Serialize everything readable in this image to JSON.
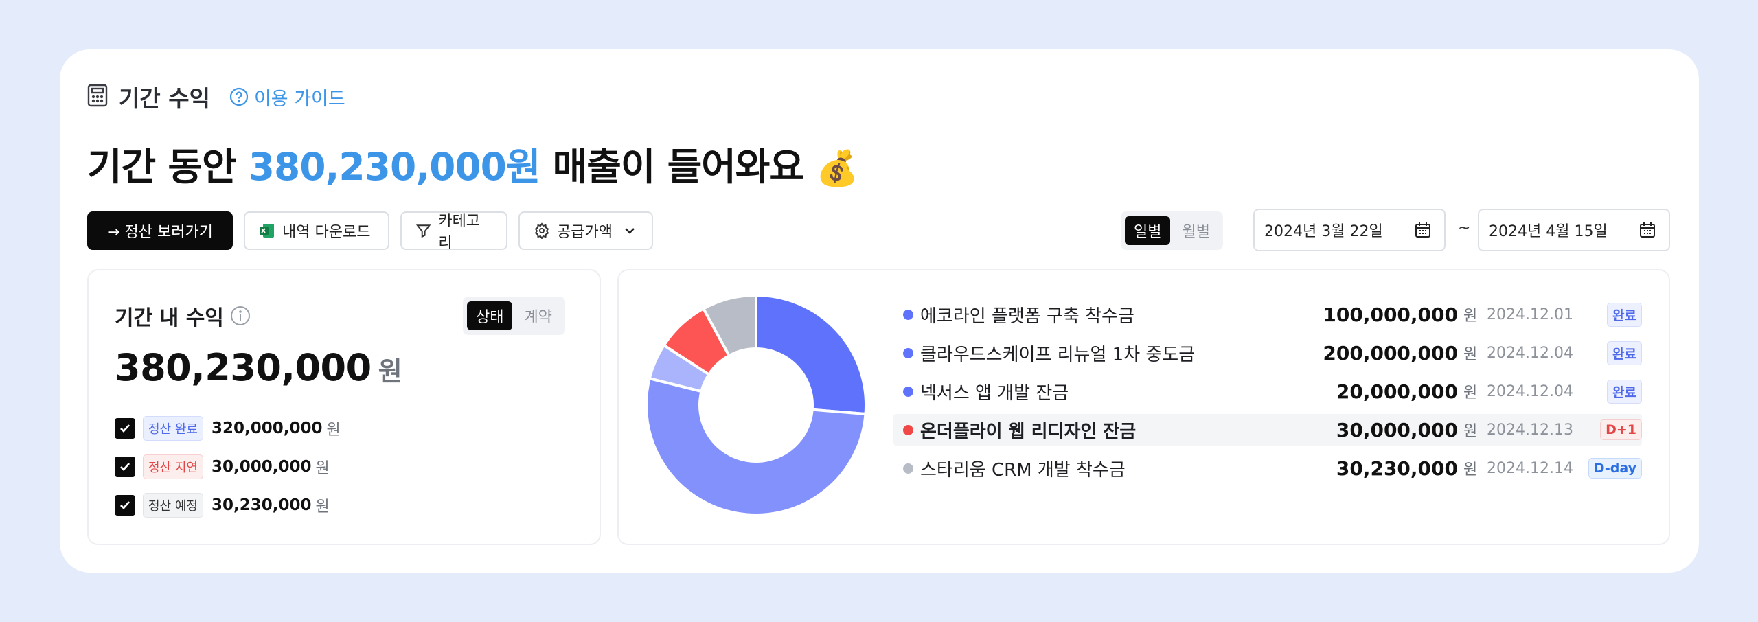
{
  "header": {
    "title": "기간 수익",
    "guide_label": "이용 가이드"
  },
  "headline": {
    "prefix": "기간 동안 ",
    "amount": "380,230,000원",
    "suffix": " 매출이 들어와요",
    "emoji": "💰"
  },
  "toolbar": {
    "settle_button": "→ 정산 보러가기",
    "download_button": "내역 다운로드",
    "category_button": "카테고리",
    "supply_button": "공급가액",
    "view_daily": "일별",
    "view_monthly": "월별",
    "date_start": "2024년 3월 22일",
    "date_sep": "~",
    "date_end": "2024년 4월 15일"
  },
  "summary": {
    "title": "기간 내 수익",
    "toggle_status": "상태",
    "toggle_contract": "계약",
    "total": "380,230,000",
    "unit": "원",
    "items": [
      {
        "tag": "정산 완료",
        "value": "320,000,000",
        "unit": "원"
      },
      {
        "tag": "정산 지연",
        "value": "30,000,000",
        "unit": "원"
      },
      {
        "tag": "정산 예정",
        "value": "30,230,000",
        "unit": "원"
      }
    ]
  },
  "chart_data": {
    "type": "pie",
    "donut": true,
    "categories": [
      "에코라인 플랫폼 구축 착수금",
      "클라우드스케이프 리뉴얼 1차 중도금",
      "넥서스 앱 개발 잔금",
      "온더플라이 웹 리디자인 잔금",
      "스타리움 CRM 개발 착수금"
    ],
    "values": [
      100000000,
      200000000,
      20000000,
      30000000,
      30230000
    ],
    "colors": [
      "#5f72fb",
      "#8391fc",
      "#aab4fd",
      "#fd5454",
      "#b8bcc7"
    ]
  },
  "list": [
    {
      "name": "에코라인 플랫폼 구축 착수금",
      "amount": "100,000,000",
      "unit": "원",
      "date": "2024.12.01",
      "status": "완료",
      "dot": "#5f72fb"
    },
    {
      "name": "클라우드스케이프 리뉴얼 1차 중도금",
      "amount": "200,000,000",
      "unit": "원",
      "date": "2024.12.04",
      "status": "완료",
      "dot": "#5f72fb"
    },
    {
      "name": "넥서스 앱 개발 잔금",
      "amount": "20,000,000",
      "unit": "원",
      "date": "2024.12.04",
      "status": "완료",
      "dot": "#5f72fb"
    },
    {
      "name": "온더플라이 웹 리디자인 잔금",
      "amount": "30,000,000",
      "unit": "원",
      "date": "2024.12.13",
      "status": "D+1",
      "dot": "#f04747"
    },
    {
      "name": "스타리움 CRM 개발 착수금",
      "amount": "30,230,000",
      "unit": "원",
      "date": "2024.12.14",
      "status": "D-day",
      "dot": "#b8bcc7"
    }
  ]
}
